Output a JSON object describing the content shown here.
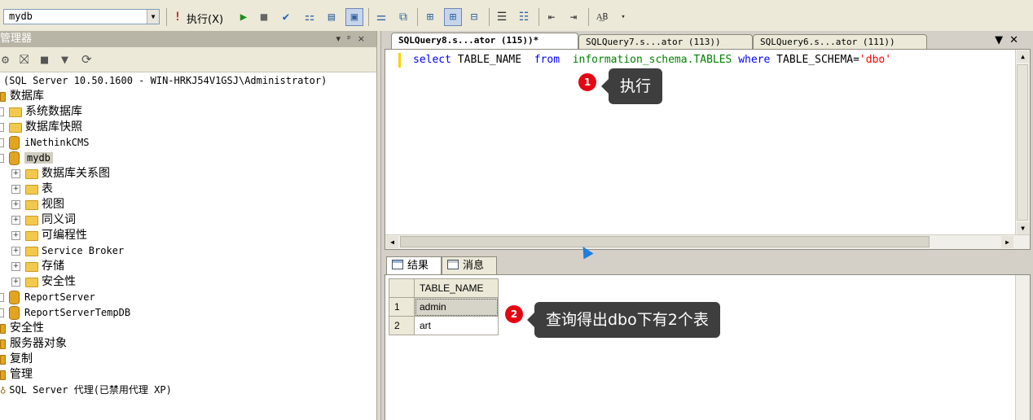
{
  "toolbar": {
    "database": "mydb",
    "execute_label": "执行(X)",
    "icons": [
      "exclamation-icon",
      "play-icon",
      "stop-icon",
      "check-icon",
      "parse-icon",
      "display-plan-icon",
      "results-grid-icon",
      "results-text-icon",
      "results-file-icon",
      "comment-icon",
      "uncomment-icon",
      "outdent-icon",
      "indent-icon",
      "spec-values-icon"
    ]
  },
  "object_explorer": {
    "title": "管理器",
    "server": "(SQL Server 10.50.1600 - WIN-HRKJ54V1GSJ\\Administrator)",
    "tree": [
      {
        "label": "数据库"
      },
      {
        "label": "系统数据库"
      },
      {
        "label": "数据库快照"
      },
      {
        "label": "iNethinkCMS"
      },
      {
        "label": "mydb"
      },
      {
        "label": "数据库关系图"
      },
      {
        "label": "表"
      },
      {
        "label": "视图"
      },
      {
        "label": "同义词"
      },
      {
        "label": "可编程性"
      },
      {
        "label": "Service Broker"
      },
      {
        "label": "存储"
      },
      {
        "label": "安全性"
      },
      {
        "label": "ReportServer"
      },
      {
        "label": "ReportServerTempDB"
      },
      {
        "label": "安全性"
      },
      {
        "label": "服务器对象"
      },
      {
        "label": "复制"
      },
      {
        "label": "管理"
      },
      {
        "label": "SQL Server 代理(已禁用代理 XP)"
      }
    ]
  },
  "tabs": [
    {
      "label": "SQLQuery8.s...ator (115))*"
    },
    {
      "label": "SQLQuery7.s...ator (113))"
    },
    {
      "label": "SQLQuery6.s...ator (111))"
    }
  ],
  "editor": {
    "kw_select": "select",
    "col": "TABLE_NAME",
    "kw_from": "from",
    "schema": "information_schema.TABLES",
    "kw_where": "where",
    "cond": "TABLE_SCHEMA=",
    "literal": "'dbo'"
  },
  "results_tabs": {
    "results": "结果",
    "messages": "消息"
  },
  "grid": {
    "header": "TABLE_NAME",
    "rows": [
      {
        "num": "1",
        "value": "admin"
      },
      {
        "num": "2",
        "value": "art"
      }
    ]
  },
  "annotations": {
    "badge1": "1",
    "callout1": "执行",
    "badge2": "2",
    "callout2": "查询得出dbo下有2个表"
  },
  "colors": {
    "keyword": "#0000ff",
    "object": "#008000",
    "string": "#ff0000",
    "badge": "#e30613",
    "callout": "#3e3e3e"
  }
}
